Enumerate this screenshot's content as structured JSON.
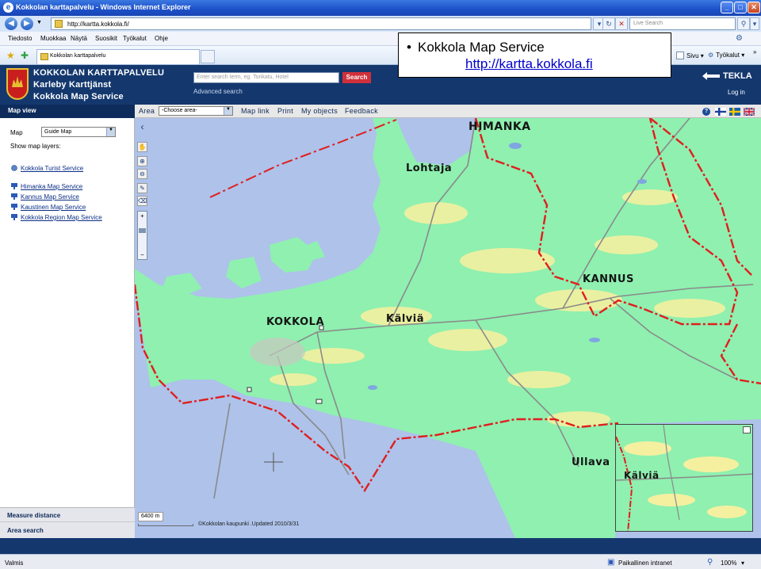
{
  "window": {
    "title": "Kokkolan karttapalvelu - Windows Internet Explorer",
    "address": "http://kartta.kokkola.fi/",
    "live_search_placeholder": "Live Search"
  },
  "menu": [
    "Tiedosto",
    "Muokkaa",
    "Näytä",
    "Suosikit",
    "Työkalut",
    "Ohje"
  ],
  "tab": {
    "label": "Kokkolan karttapalvelu"
  },
  "toolbar_right": {
    "page": "Sivu",
    "tools": "Työkalut"
  },
  "header": {
    "line1": "KOKKOLAN KARTTAPALVELU",
    "line2": "Karleby Karttjänst",
    "line3": "Kokkola Map Service",
    "search_placeholder": "Enter search term, eg. Torikatu, Hotel",
    "search_button": "Search",
    "advanced_search": "Advanced search",
    "brand": "TEKLA",
    "login": "Log in"
  },
  "map_toolbar": {
    "map_view": "Map view",
    "area_label": "Area",
    "area_select": "-Choose area-",
    "links": [
      "Map link",
      "Print",
      "My objects",
      "Feedback"
    ],
    "help": "?"
  },
  "left_panel": {
    "map_label": "Map",
    "map_select": "Guide Map",
    "show_layers": "Show map layers:",
    "tourist_service": "Kokkola Turist Service",
    "services": [
      "Himanka Map Service",
      "Kannus Map Service",
      "Kaustinen Map Service",
      "Kokkola Region Map Service"
    ],
    "measure_distance": "Measure distance",
    "area_search": "Area search"
  },
  "map": {
    "places": {
      "himanka": "HIMANKA",
      "lohtaja": "Lohtaja",
      "kannus": "KANNUS",
      "kokkola": "KOKKOLA",
      "kalvia": "Kälviä",
      "ullava": "Ullava"
    },
    "overview_place": "Kälviä",
    "scale": "6400 m",
    "copyright": "©Kokkolan kaupunki .Updated 2010/3/31",
    "colors": {
      "sea": "#aec2ea",
      "land": "#8ff0b0",
      "field": "#f4f0a0",
      "boundary": "#e01e1e",
      "road": "#8a8a8a"
    }
  },
  "status": {
    "left": "Valmis",
    "zone": "Paikallinen intranet",
    "zoom": "100%"
  },
  "popup": {
    "bullet": "•",
    "title": "Kokkola Map Service",
    "url": "http://kartta.kokkola.fi"
  }
}
